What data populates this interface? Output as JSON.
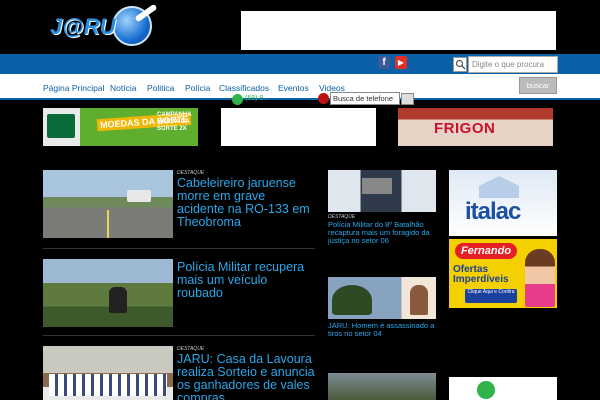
{
  "header": {
    "logo_text": "J@RU"
  },
  "social": {
    "facebook_label": "f",
    "youtube_label": "▶"
  },
  "search": {
    "placeholder": "Digite o que procura",
    "button_label": "buscar"
  },
  "nav": {
    "items": [
      {
        "label": "Página Principal"
      },
      {
        "label": "Notícia"
      },
      {
        "label": "Politica"
      },
      {
        "label": "Polícia"
      },
      {
        "label": "Classificados"
      },
      {
        "label": "Eventos"
      },
      {
        "label": "Videos"
      }
    ]
  },
  "phone_search": {
    "whatsapp_text": "(69) 9...",
    "placeholder": "Busca de telefone"
  },
  "ads": {
    "moedas_label": "MOEDAS DA SORTE",
    "moedas_side": "CAMPANHA MOEDA DA SORTE 2X",
    "frigon_label": "FRIGON",
    "italac_label": "italac",
    "fernando_label": "Fernando",
    "fernando_offer": "Ofertas Imperdíveis",
    "fernando_cta": "Clique Aqui e Confira"
  },
  "news": [
    {
      "category": "DESTAQUE",
      "title": "Cabeleireiro jaruense morre em grave acidente na RO-133 em Theobroma"
    },
    {
      "category": "",
      "title": "Polícia Militar recupera mais um veículo roubado"
    },
    {
      "category": "DESTAQUE",
      "title": "JARU: Casa da Lavoura realiza Sorteio e anuncia os ganhadores de vales compras"
    }
  ],
  "side_news": [
    {
      "category": "DESTAQUE",
      "title": "Polícia Militar do 8º Batalhão recaptura mais um foragido da justiça no setor 06"
    },
    {
      "category": "",
      "title": "JARU: Homem é assassinado a tiros no setor 04"
    }
  ],
  "colors": {
    "brand_blue": "#0b5fa7",
    "link_blue": "#2aa7e8",
    "background": "#000000"
  }
}
